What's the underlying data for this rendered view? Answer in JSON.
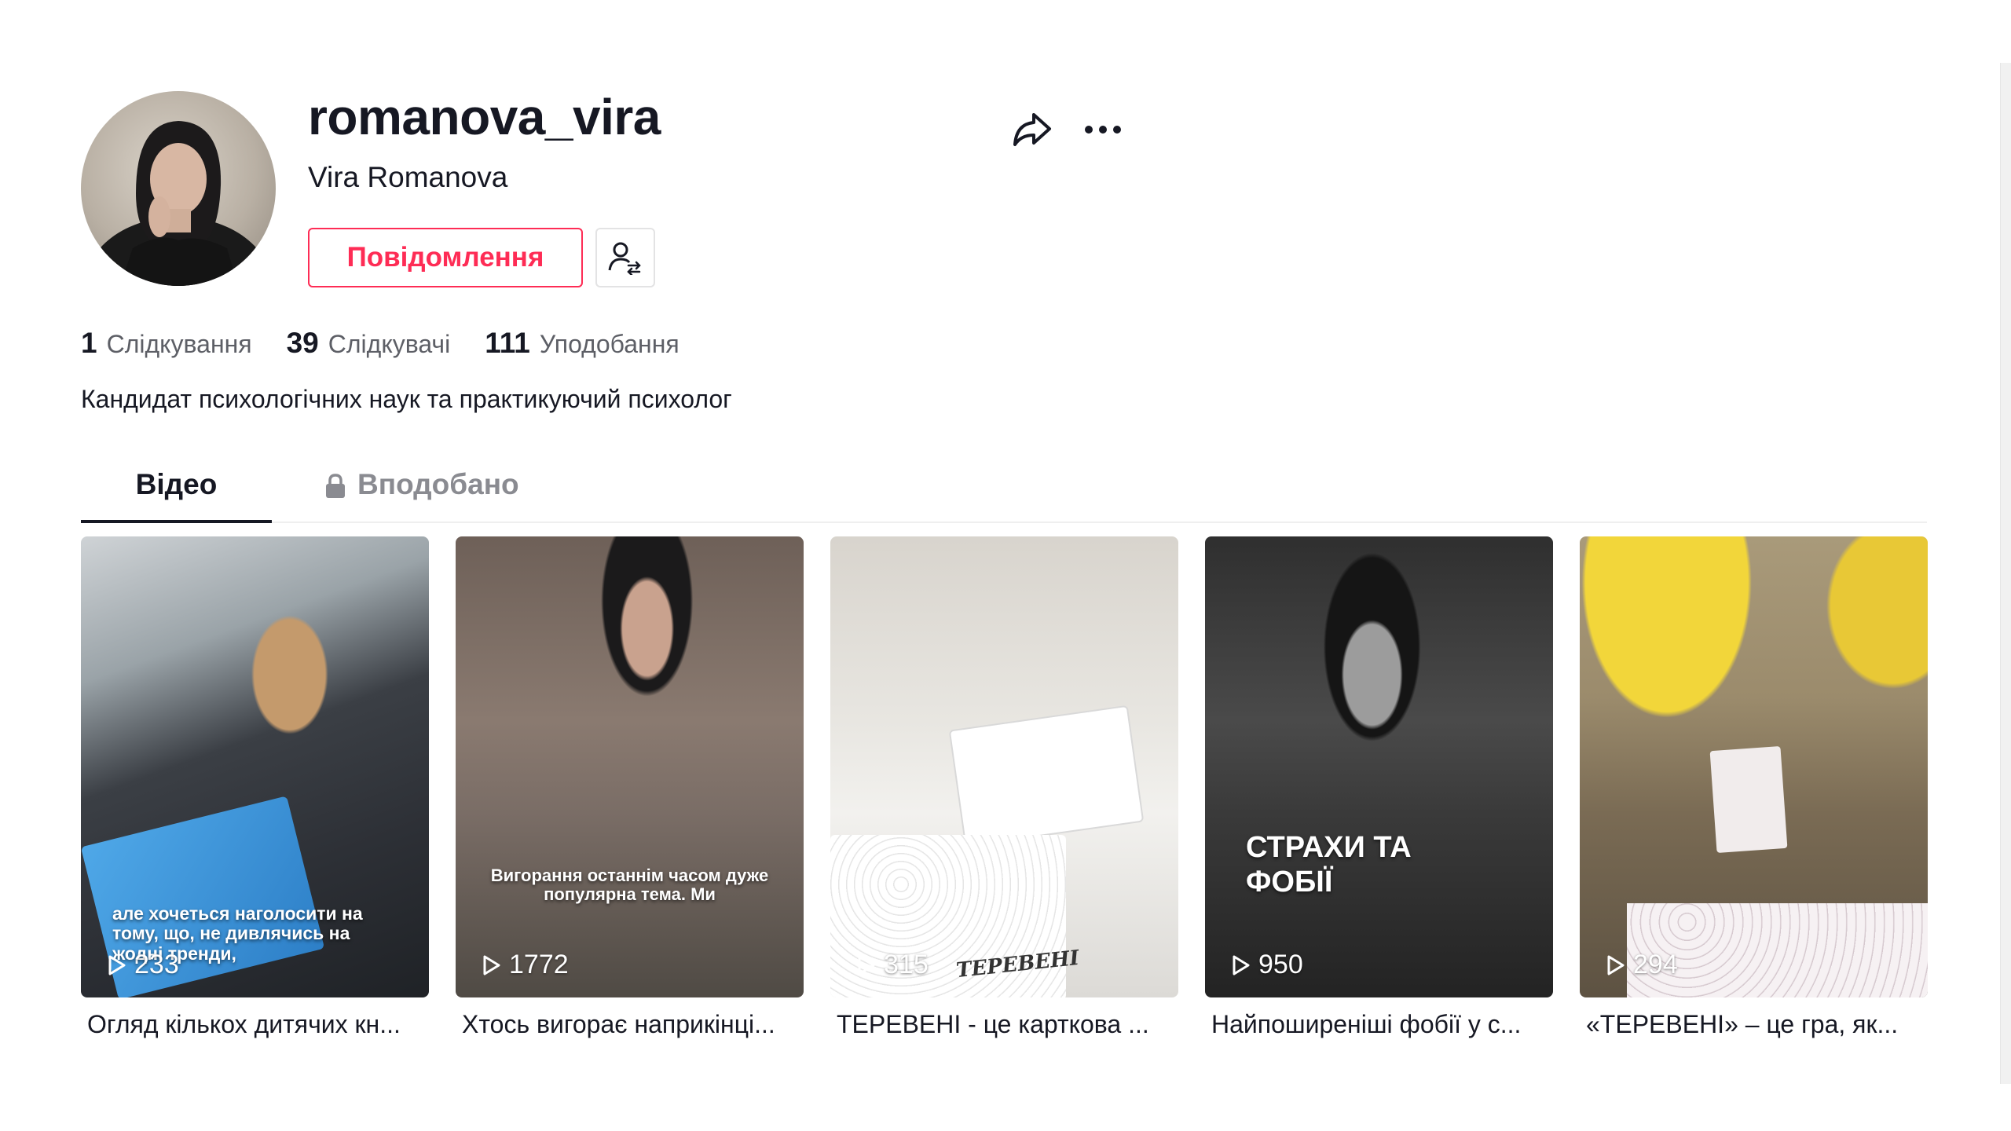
{
  "profile": {
    "username": "romanova_vira",
    "display_name": "Vira Romanova",
    "message_label": "Повідомлення",
    "bio": "Кандидат психологічних наук та практикуючий психолог"
  },
  "stats": [
    {
      "value": "1",
      "label": "Слідкування"
    },
    {
      "value": "39",
      "label": "Слідкувачі"
    },
    {
      "value": "111",
      "label": "Уподобання"
    }
  ],
  "tabs": {
    "videos": "Відео",
    "liked": "Вподобано"
  },
  "icons": {
    "share": "share-icon",
    "more": "more-icon",
    "follow_suggest": "person-switch-icon",
    "lock": "lock-icon",
    "play": "play-icon"
  },
  "colors": {
    "accent": "#fe2c55",
    "text": "#161823",
    "muted": "#5d5f66",
    "tab_inactive": "#8a8b91"
  },
  "videos": [
    {
      "views": "233",
      "caption": "Огляд кількох дитячих кн...",
      "overlay": "але хочеться наголосити на тому, що, не дивлячись на жодні тренди,"
    },
    {
      "views": "1772",
      "caption": "Хтось вигорає наприкінці...",
      "overlay": "Вигорання останнім часом дуже популярна тема. Ми"
    },
    {
      "views": "315",
      "caption": "ТЕРЕВЕНІ - це карткова ...",
      "overlay": "ТЕРЕВЕНІ"
    },
    {
      "views": "950",
      "caption": "Найпоширеніші фобії у с...",
      "overlay": "СТРАХИ ТА ФОБІЇ"
    },
    {
      "views": "294",
      "caption": "«ТЕРЕВЕНІ» – це гра, як...",
      "overlay": ""
    }
  ]
}
